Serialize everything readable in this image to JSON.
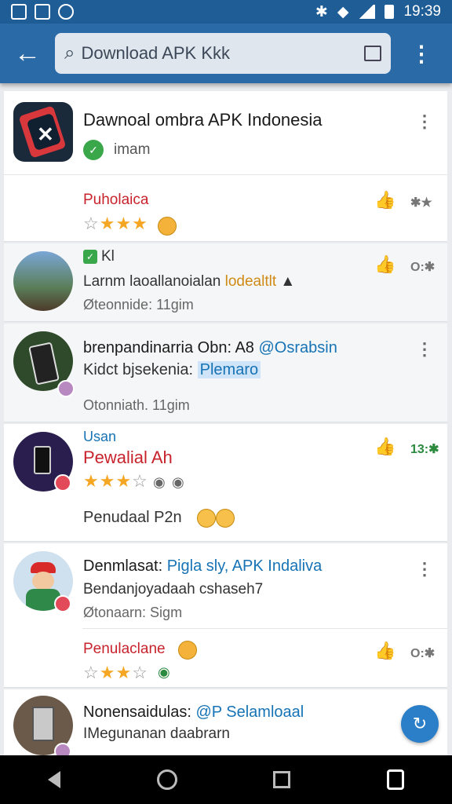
{
  "status": {
    "time": "19:39"
  },
  "search": {
    "query": "Download APK Kkk"
  },
  "posts": [
    {
      "title": "Dawnoal ombra APK Indonesia",
      "author": "imam",
      "reply_label": "Puholaica",
      "rating": 3,
      "rating_count": "",
      "like_count": "✱★"
    },
    {
      "tag": "Kl",
      "line1a": "Larnm laoallanoialan ",
      "line1b": "lodealtlt",
      "meta": "Øteonnide: 11gim",
      "like_count": "O:✱"
    },
    {
      "title_a": "brenpandinarria Obn: A8 ",
      "title_b": "@Osrabsin",
      "line2a": "Kidct bjsekenia: ",
      "line2b": "Plemaro",
      "meta": "Otonniath. 11gim"
    },
    {
      "tag": "Usan",
      "title": "Pewalial Ah",
      "rating": 3,
      "caption": "Penudaal P2n",
      "like_count": "13:✱"
    },
    {
      "title_a": "Denmlasat: ",
      "title_b": "Pigla sly, APK Indaliva",
      "line2": "Bendanjoyadaah cshaseh7",
      "meta": "Øtonaarn: Sigm",
      "reply_label": "Penulaclane",
      "rating": 3,
      "like_count": "O:✱"
    },
    {
      "title_a": "Nonensaidulas: ",
      "title_b": "@P Selamloaal",
      "line2": "IMegunanan daabrarn"
    }
  ]
}
